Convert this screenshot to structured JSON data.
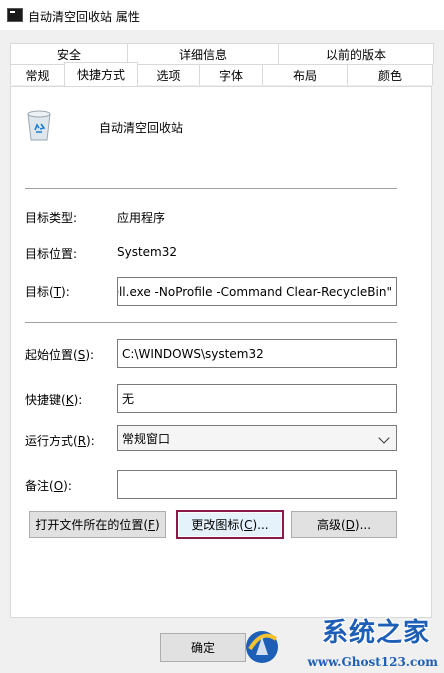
{
  "window": {
    "title": "自动清空回收站 属性"
  },
  "tabs_row1": [
    "安全",
    "详细信息",
    "以前的版本"
  ],
  "tabs_row2": [
    "常规",
    "快捷方式",
    "选项",
    "字体",
    "布局",
    "颜色"
  ],
  "active_tab": "快捷方式",
  "shortcut": {
    "name": "自动清空回收站",
    "target_type_label": "目标类型:",
    "target_type_value": "应用程序",
    "target_location_label": "目标位置:",
    "target_location_value": "System32",
    "target_label_pre": "目标(",
    "target_label_key": "T",
    "target_label_post": "):",
    "target_value": "ell.exe -NoProfile -Command Clear-RecycleBin\"",
    "start_label_pre": "起始位置(",
    "start_label_key": "S",
    "start_label_post": "):",
    "start_value": "C:\\WINDOWS\\system32",
    "hotkey_label_pre": "快捷键(",
    "hotkey_label_key": "K",
    "hotkey_label_post": "):",
    "hotkey_value": "无",
    "run_label_pre": "运行方式(",
    "run_label_key": "R",
    "run_label_post": "):",
    "run_value": "常规窗口",
    "comment_label_pre": "备注(",
    "comment_label_key": "O",
    "comment_label_post": "):",
    "comment_value": ""
  },
  "buttons": {
    "open_location_pre": "打开文件所在的位置(",
    "open_location_key": "F",
    "open_location_post": ")",
    "change_icon_pre": "更改图标(",
    "change_icon_key": "C",
    "change_icon_post": ")...",
    "advanced_pre": "高级(",
    "advanced_key": "D",
    "advanced_post": ")...",
    "ok": "确定"
  },
  "watermark": {
    "title": "系统之家",
    "url": "www.Ghost123.com"
  },
  "colors": {
    "focus_border": "#8b1a4a",
    "watermark_blue": "#1d5fb6"
  }
}
